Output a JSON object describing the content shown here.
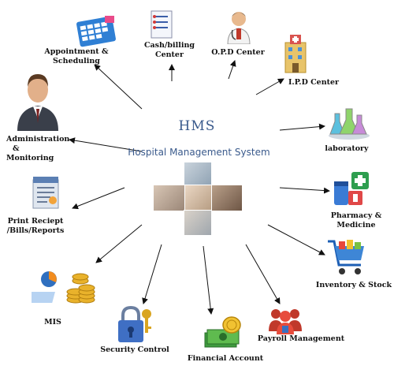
{
  "center": {
    "title": "HMS",
    "subtitle": "Hospital Management System"
  },
  "modules": {
    "appointment": {
      "line1": "Appointment &",
      "line2": "Scheduling"
    },
    "cash_billing": {
      "line1": "Cash/billing",
      "line2": "Center"
    },
    "opd": {
      "line1": "O.P.D Center"
    },
    "ipd": {
      "line1": "I.P.D Center"
    },
    "laboratory": {
      "line1": "laboratory"
    },
    "pharmacy": {
      "line1": "Pharmacy &",
      "line2": "Medicine"
    },
    "inventory": {
      "line1": "Inventory & Stock"
    },
    "payroll": {
      "line1": "Payroll Management"
    },
    "financial": {
      "line1": "Financial Account"
    },
    "security": {
      "line1": "Security Control"
    },
    "mis": {
      "line1": "MIS"
    },
    "print_receipt": {
      "line1": "Print Reciept",
      "line2": "/Bills/Reports"
    },
    "administration": {
      "line1": "Administration",
      "line2": "&",
      "line3": "Monitoring"
    }
  },
  "colors": {
    "title": "#3a5a8c",
    "arrow": "#111111"
  },
  "icons": [
    "calendar-icon",
    "clipboard-icon",
    "doctor-icon",
    "building-icon",
    "flasks-icon",
    "medicine-icon",
    "cart-icon",
    "people-icon",
    "money-icon",
    "padlock-icon",
    "coins-chart-icon",
    "report-icon",
    "businessman-icon"
  ]
}
